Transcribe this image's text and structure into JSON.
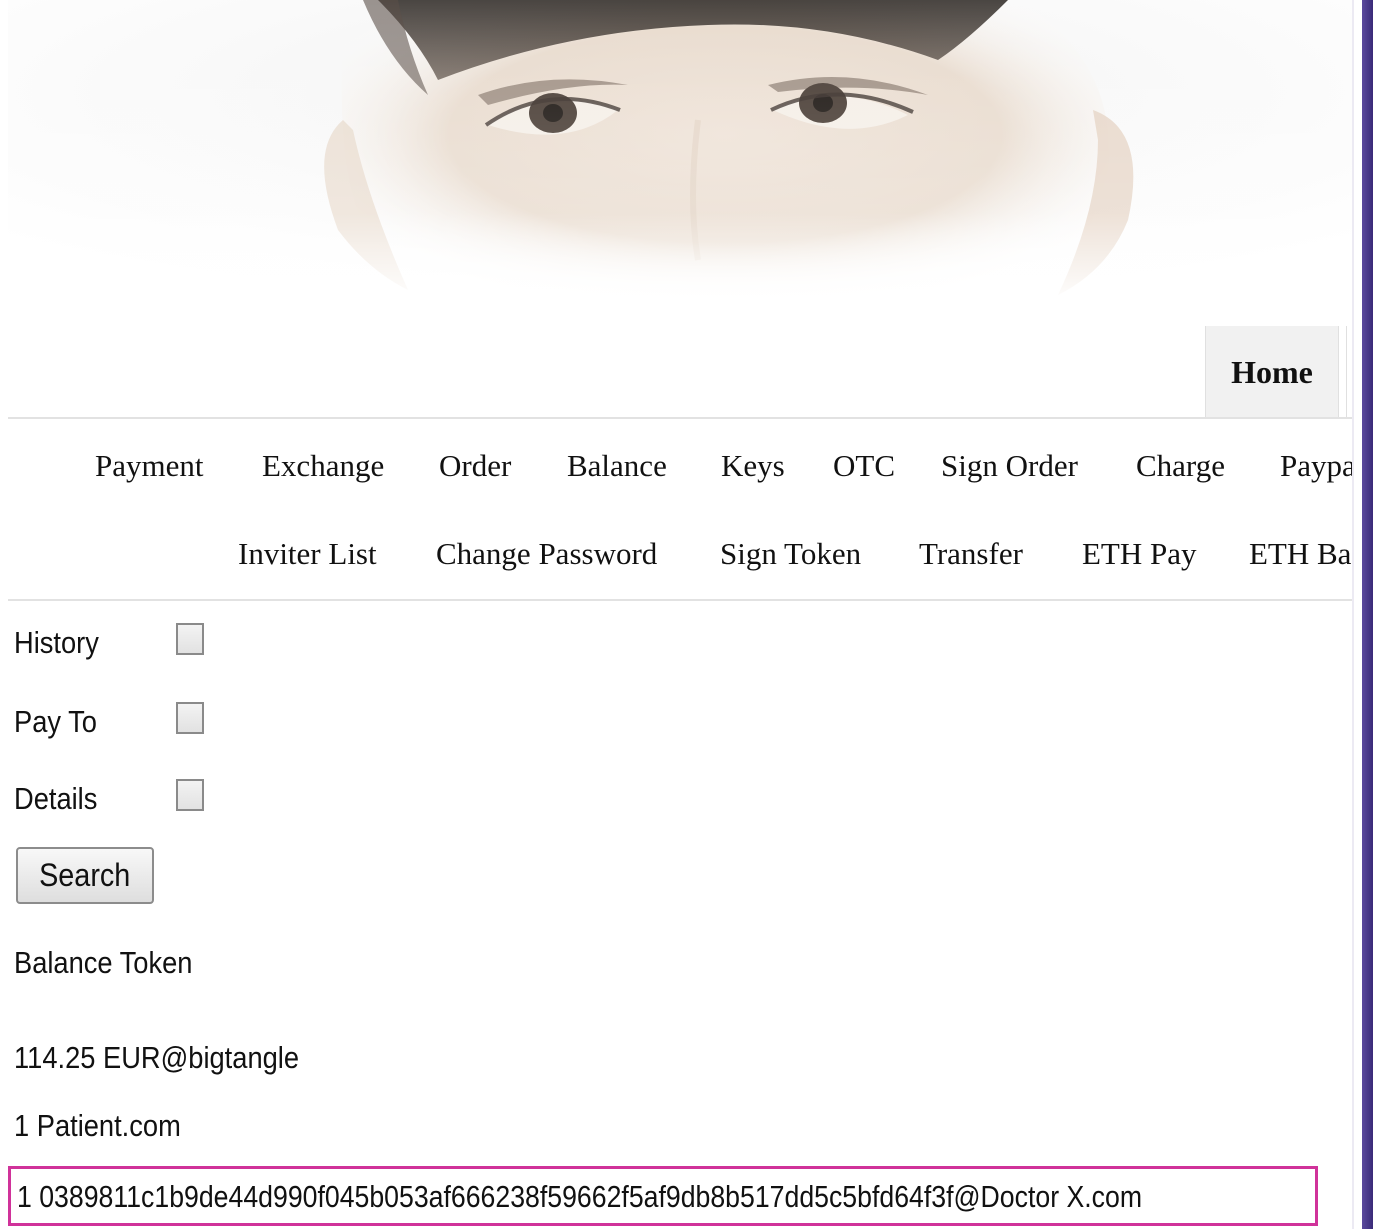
{
  "header": {
    "banner_image": "smiling-man-face-photo"
  },
  "nav": {
    "home_label": "Home"
  },
  "subnav": {
    "row1": [
      "Payment",
      "Exchange",
      "Order",
      "Balance",
      "Keys",
      "OTC",
      "Sign Order",
      "Charge",
      "Paypal"
    ],
    "row2": [
      "Inviter List",
      "Change Password",
      "Sign Token",
      "Transfer",
      "ETH Pay",
      "ETH Balance"
    ]
  },
  "form": {
    "history_label": "History",
    "history_checked": false,
    "payto_label": "Pay To",
    "payto_checked": false,
    "details_label": "Details",
    "details_checked": false,
    "search_label": "Search"
  },
  "results": {
    "heading": "Balance Token",
    "items": [
      "114.25 EUR@bigtangle",
      "1 Patient.com",
      "1 0389811c1b9de44d990f045b053af666238f59662f5af9db8b517dd5c5bfd64f3f@Doctor X.com"
    ]
  },
  "colors": {
    "highlight_border": "#d0329a",
    "right_rail": "#3a2b78"
  }
}
